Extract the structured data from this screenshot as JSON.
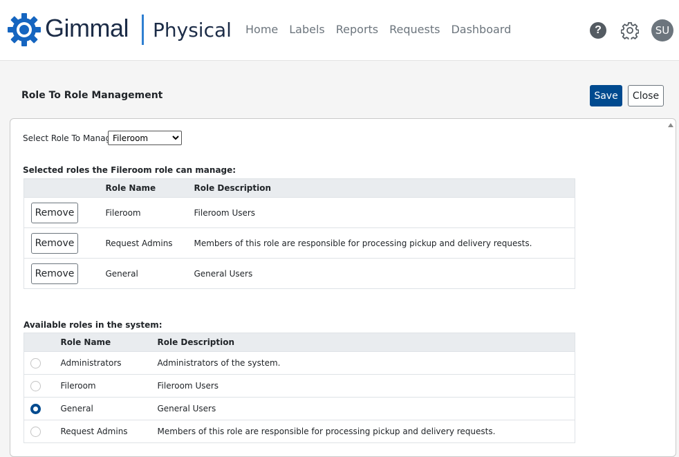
{
  "header": {
    "logo_text": "Gimmal",
    "product": "Physical",
    "nav": [
      "Home",
      "Labels",
      "Reports",
      "Requests",
      "Dashboard"
    ],
    "help_glyph": "?",
    "avatar_initials": "SU",
    "icons": {
      "logo": "gear-logo-icon",
      "help": "help-icon",
      "settings": "gear-icon"
    }
  },
  "page": {
    "title": "Role To Role Management",
    "save_label": "Save",
    "close_label": "Close"
  },
  "selector": {
    "label": "Select Role To Manage:",
    "selected": "Fileroom"
  },
  "selected_roles": {
    "heading": "Selected roles the Fileroom role can manage:",
    "columns": [
      "",
      "Role Name",
      "Role Description"
    ],
    "remove_label": "Remove",
    "rows": [
      {
        "name": "Fileroom",
        "description": "Fileroom Users"
      },
      {
        "name": "Request Admins",
        "description": "Members of this role are responsible for processing pickup and delivery requests."
      },
      {
        "name": "General",
        "description": "General Users"
      }
    ]
  },
  "available_roles": {
    "heading": "Available roles in the system:",
    "columns": [
      "",
      "Role Name",
      "Role Description"
    ],
    "rows": [
      {
        "name": "Administrators",
        "description": "Administrators of the system.",
        "checked": false
      },
      {
        "name": "Fileroom",
        "description": "Fileroom Users",
        "checked": false
      },
      {
        "name": "General",
        "description": "General Users",
        "checked": true
      },
      {
        "name": "Request Admins",
        "description": "Members of this role are responsible for processing pickup and delivery requests.",
        "checked": false
      }
    ]
  },
  "colors": {
    "primary": "#004a8f",
    "brand_text": "#1c2c47",
    "brand_accent": "#2f7fd1",
    "logo_gear": "#1565c0"
  }
}
